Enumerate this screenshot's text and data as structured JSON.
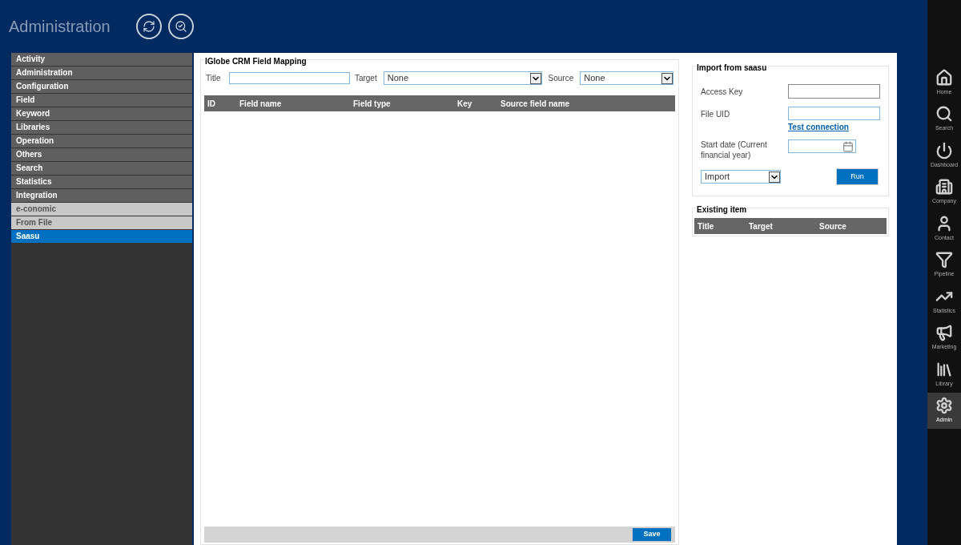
{
  "header": {
    "title": "Administration"
  },
  "sidebar": {
    "items": [
      {
        "label": "Activity",
        "kind": "section",
        "selected": false
      },
      {
        "label": "Administration",
        "kind": "section",
        "selected": false
      },
      {
        "label": "Configuration",
        "kind": "section",
        "selected": false
      },
      {
        "label": "Field",
        "kind": "section",
        "selected": false
      },
      {
        "label": "Keyword",
        "kind": "section",
        "selected": false
      },
      {
        "label": "Libraries",
        "kind": "section",
        "selected": false
      },
      {
        "label": "Operation",
        "kind": "section",
        "selected": false
      },
      {
        "label": "Others",
        "kind": "section",
        "selected": false
      },
      {
        "label": "Search",
        "kind": "section",
        "selected": false
      },
      {
        "label": "Statistics",
        "kind": "section",
        "selected": false
      },
      {
        "label": "Integration",
        "kind": "section",
        "selected": false
      },
      {
        "label": "e-conomic",
        "kind": "sub",
        "selected": false
      },
      {
        "label": "From File",
        "kind": "sub",
        "selected": false
      },
      {
        "label": "Saasu",
        "kind": "sub",
        "selected": true
      }
    ]
  },
  "mapping": {
    "title": "IGlobe CRM Field Mapping",
    "title_label": "Title",
    "target_label": "Target",
    "target_value": "None",
    "source_label": "Source",
    "source_value": "None",
    "columns": [
      "ID",
      "Field name",
      "Field type",
      "Key",
      "Source field name"
    ],
    "save": "Save"
  },
  "import": {
    "title": "Import from saasu",
    "access_key_label": "Access Key",
    "file_uid_label": "File UID",
    "test_link": "Test connection",
    "start_date_label": "Start date (Current financial year)",
    "mode_value": "Import",
    "run": "Run"
  },
  "existing": {
    "title": "Existing item",
    "columns": [
      "Title",
      "Target",
      "Source"
    ]
  },
  "nav": [
    {
      "label": "Home",
      "selected": false
    },
    {
      "label": "Search",
      "selected": false
    },
    {
      "label": "Dashboard",
      "selected": false
    },
    {
      "label": "Company",
      "selected": false
    },
    {
      "label": "Contact",
      "selected": false
    },
    {
      "label": "Pipeline",
      "selected": false
    },
    {
      "label": "Statistics",
      "selected": false
    },
    {
      "label": "Marketing",
      "selected": false
    },
    {
      "label": "Library",
      "selected": false
    },
    {
      "label": "Admin",
      "selected": true
    }
  ]
}
